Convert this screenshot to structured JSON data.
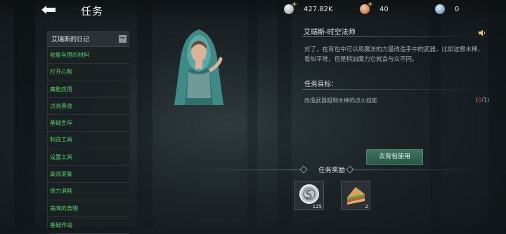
{
  "header": {
    "title": "任务",
    "currencies": [
      {
        "icon": "silver-coin-icon",
        "value": "427.82K"
      },
      {
        "icon": "food-icon",
        "value": "40"
      },
      {
        "icon": "gem-icon",
        "value": "0"
      }
    ]
  },
  "diary": {
    "title": "艾瑞斯的日记",
    "items": [
      "收集有用的材料",
      "打开心智",
      "魔能应用",
      "点亮黑夜",
      "基础生存",
      "制造工具",
      "设置工具",
      "高效采集",
      "体力消耗",
      "美味的食物",
      "基础作战"
    ]
  },
  "quest": {
    "npc_name": "艾瑞斯-时空法师",
    "dialog": "对了，在背包中可以用魔法的力量改造手中的武器，比如这根木棒，看似平常，但是稍加魔力它就会与众不同。",
    "goal_title": "任务目标：",
    "goal_text": "改造武器粗制木棒的点火技能",
    "goal_current": "0",
    "goal_total": "/1)",
    "goal_open": "(",
    "use_button": "去背包使用"
  },
  "rewards": {
    "title": "任务奖励",
    "items": [
      {
        "icon": "silver-coin-icon",
        "count": "125"
      },
      {
        "icon": "sandwich-icon",
        "count": "2"
      }
    ]
  },
  "colors": {
    "accent_green": "#58d06a",
    "progress_red": "#e04848",
    "button_green": "#3e7560"
  }
}
